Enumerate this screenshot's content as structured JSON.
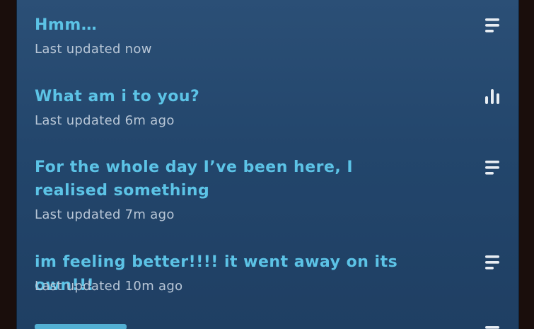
{
  "items": [
    {
      "title": "Hmm…",
      "meta": "Last updated now",
      "icon": "text-lines-icon"
    },
    {
      "title": "What am i to you?",
      "meta": "Last updated 6m ago",
      "icon": "poll-bars-icon"
    },
    {
      "title": "For the whole day I’ve been here, I realised something",
      "meta": "Last updated 7m ago",
      "icon": "text-lines-icon"
    },
    {
      "title": "im feeling better!!!! it went away on its own!!!",
      "meta": "Last updated 10m ago",
      "icon": "text-lines-icon"
    }
  ],
  "colors": {
    "title": "#5cc3e6",
    "meta": "#b8c6d6",
    "panel": "#25486e",
    "background": "#1a0e0c",
    "icon": "#e8edf3"
  }
}
